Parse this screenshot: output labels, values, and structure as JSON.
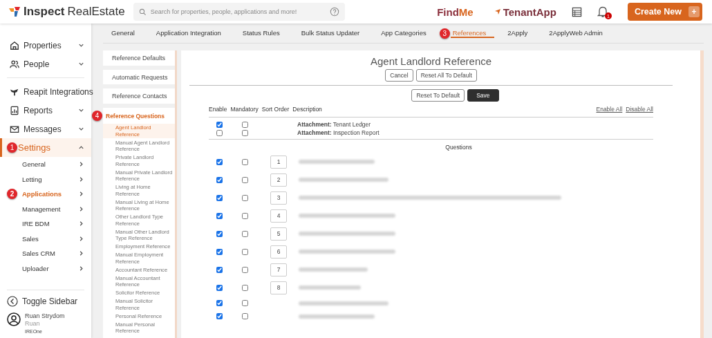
{
  "header": {
    "logo_bold": "Inspect",
    "logo_light": "RealEstate",
    "search": {
      "placeholder": "Search for properties, people, applications and more!"
    },
    "findme": {
      "first": "Find",
      "second": "Me"
    },
    "tenantapp": "TenantApp",
    "notification_count": "1",
    "create_new": {
      "label": "Create New",
      "plus": "+"
    }
  },
  "sidebar": {
    "groups": [
      {
        "items": [
          {
            "label": "Properties",
            "expanded": false,
            "selected": false
          },
          {
            "label": "People",
            "expanded": false,
            "selected": false
          }
        ]
      },
      {
        "items": [
          {
            "label": "Reapit Integrations",
            "selected": false
          },
          {
            "label": "Reports",
            "expanded": false,
            "selected": false
          },
          {
            "label": "Messages",
            "expanded": false,
            "selected": false
          },
          {
            "label": "Settings",
            "expanded": true,
            "selected": true,
            "badge": "1",
            "children": [
              {
                "label": "General",
                "selected": false
              },
              {
                "label": "Letting",
                "selected": false
              },
              {
                "label": "Applications",
                "selected": true,
                "badge": "2"
              },
              {
                "label": "Management",
                "selected": false
              },
              {
                "label": "IRE BDM",
                "selected": false
              },
              {
                "label": "Sales",
                "selected": false
              },
              {
                "label": "Sales CRM",
                "selected": false
              },
              {
                "label": "Uploader",
                "selected": false
              }
            ]
          }
        ]
      }
    ],
    "toggle": "Toggle Sidebar",
    "user": {
      "name": "Ruan Strydom",
      "username": "Ruan",
      "org": "IREOne"
    }
  },
  "tabs": [
    {
      "label": "General",
      "selected": false
    },
    {
      "label": "Application Integration",
      "selected": false
    },
    {
      "label": "Status Rules",
      "selected": false
    },
    {
      "label": "Bulk Status Updater",
      "selected": false
    },
    {
      "label": "App Categories",
      "selected": false
    },
    {
      "label": "References",
      "selected": true,
      "badge": "3"
    },
    {
      "label": "2Apply",
      "selected": false
    },
    {
      "label": "2ApplyWeb Admin",
      "selected": false
    }
  ],
  "reference_menu": {
    "sections": [
      {
        "label": "Reference Defaults",
        "selected": false
      },
      {
        "label": "Automatic Requests",
        "selected": false
      },
      {
        "label": "Reference Contacts",
        "selected": false
      },
      {
        "label": "Reference Questions",
        "selected": true,
        "badge": "4"
      }
    ],
    "items": [
      {
        "label": "Agent Landlord Reference",
        "selected": true
      },
      {
        "label": "Manual Agent Landlord Reference",
        "selected": false
      },
      {
        "label": "Private Landlord Reference",
        "selected": false
      },
      {
        "label": "Manual Private Landlord Reference",
        "selected": false
      },
      {
        "label": "Living at Home Reference",
        "selected": false
      },
      {
        "label": "Manual Living at Home Reference",
        "selected": false
      },
      {
        "label": "Other Landlord Type Reference",
        "selected": false
      },
      {
        "label": "Manual Other Landlord Type Reference",
        "selected": false
      },
      {
        "label": "Employment Reference",
        "selected": false
      },
      {
        "label": "Manual Employment Reference",
        "selected": false
      },
      {
        "label": "Accountant Reference",
        "selected": false
      },
      {
        "label": "Manual Accountant Reference",
        "selected": false
      },
      {
        "label": "Solicitor Reference",
        "selected": false
      },
      {
        "label": "Manual Solicitor Reference",
        "selected": false
      },
      {
        "label": "Personal Reference",
        "selected": false
      },
      {
        "label": "Manual Personal Reference",
        "selected": false
      }
    ]
  },
  "editor": {
    "title": "Agent Landlord Reference",
    "top_buttons": [
      "Cancel",
      "Reset All To Default"
    ],
    "reset_button": "Reset To Default",
    "save_button": "Save",
    "columns": [
      "Enable",
      "Mandatory",
      "Sort Order",
      "Description"
    ],
    "enable_all": "Enable All",
    "disable_all": "Disable All",
    "attachments": [
      {
        "enabled": true,
        "mandatory": false,
        "text": "**Attachment:** Tenant Ledger"
      },
      {
        "enabled": false,
        "mandatory": false,
        "text": "**Attachment:** Inspection Report"
      }
    ],
    "questions_heading": "Questions",
    "questions": [
      {
        "enabled": true,
        "mandatory": false,
        "sort_order": "1"
      },
      {
        "enabled": true,
        "mandatory": false,
        "sort_order": "2"
      },
      {
        "enabled": true,
        "mandatory": false,
        "sort_order": "3"
      },
      {
        "enabled": true,
        "mandatory": false,
        "sort_order": "4"
      },
      {
        "enabled": true,
        "mandatory": false,
        "sort_order": "5"
      },
      {
        "enabled": true,
        "mandatory": false,
        "sort_order": "6"
      },
      {
        "enabled": true,
        "mandatory": false,
        "sort_order": "7"
      },
      {
        "enabled": true,
        "mandatory": false,
        "sort_order": "8"
      },
      {
        "enabled": true,
        "mandatory": false
      },
      {
        "enabled": true,
        "mandatory": false
      }
    ]
  }
}
